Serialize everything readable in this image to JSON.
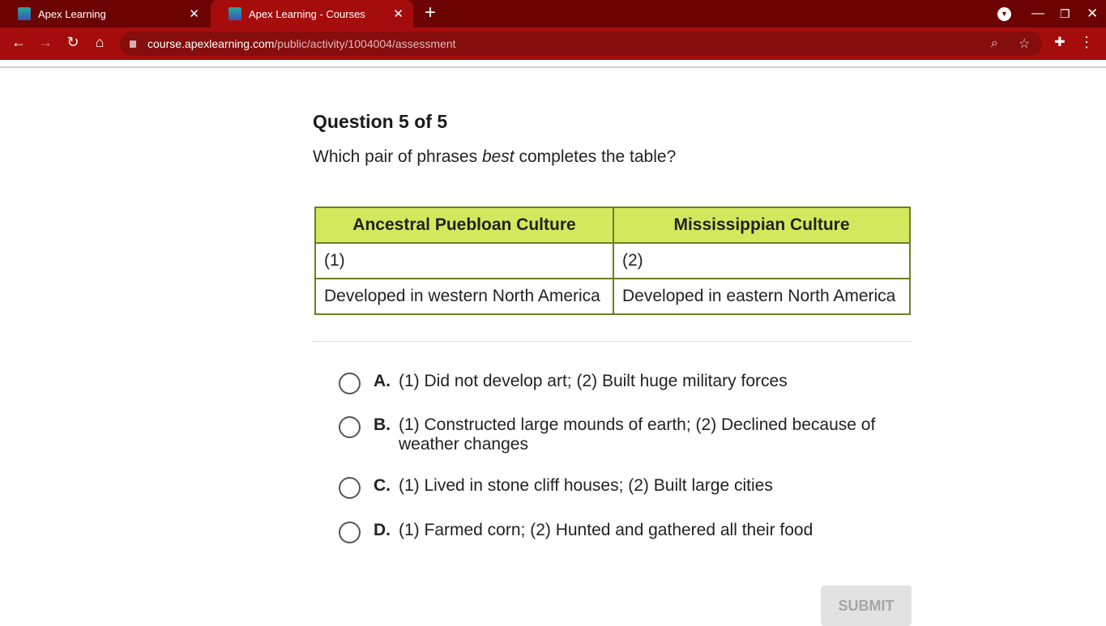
{
  "browser": {
    "tabs": [
      {
        "label": "Apex Learning"
      },
      {
        "label": "Apex Learning - Courses"
      }
    ],
    "url_host": "course.apexlearning.com",
    "url_path": "/public/activity/1004004/assessment"
  },
  "question": {
    "title": "Question 5 of 5",
    "text_before": "Which pair of phrases ",
    "text_em": "best",
    "text_after": " completes the table?"
  },
  "table": {
    "headers": [
      "Ancestral Puebloan Culture",
      "Mississippian Culture"
    ],
    "rows": [
      [
        "(1)",
        "(2)"
      ],
      [
        "Developed in western North America",
        "Developed in eastern North America"
      ]
    ]
  },
  "options": [
    {
      "letter": "A.",
      "text": "(1) Did not develop art; (2) Built huge military forces"
    },
    {
      "letter": "B.",
      "text": "(1) Constructed large mounds of earth; (2) Declined because of weather changes"
    },
    {
      "letter": "C.",
      "text": "(1) Lived in stone cliff houses; (2) Built large cities"
    },
    {
      "letter": "D.",
      "text": "(1) Farmed corn; (2) Hunted and gathered all their food"
    }
  ],
  "submit_label": "SUBMIT"
}
